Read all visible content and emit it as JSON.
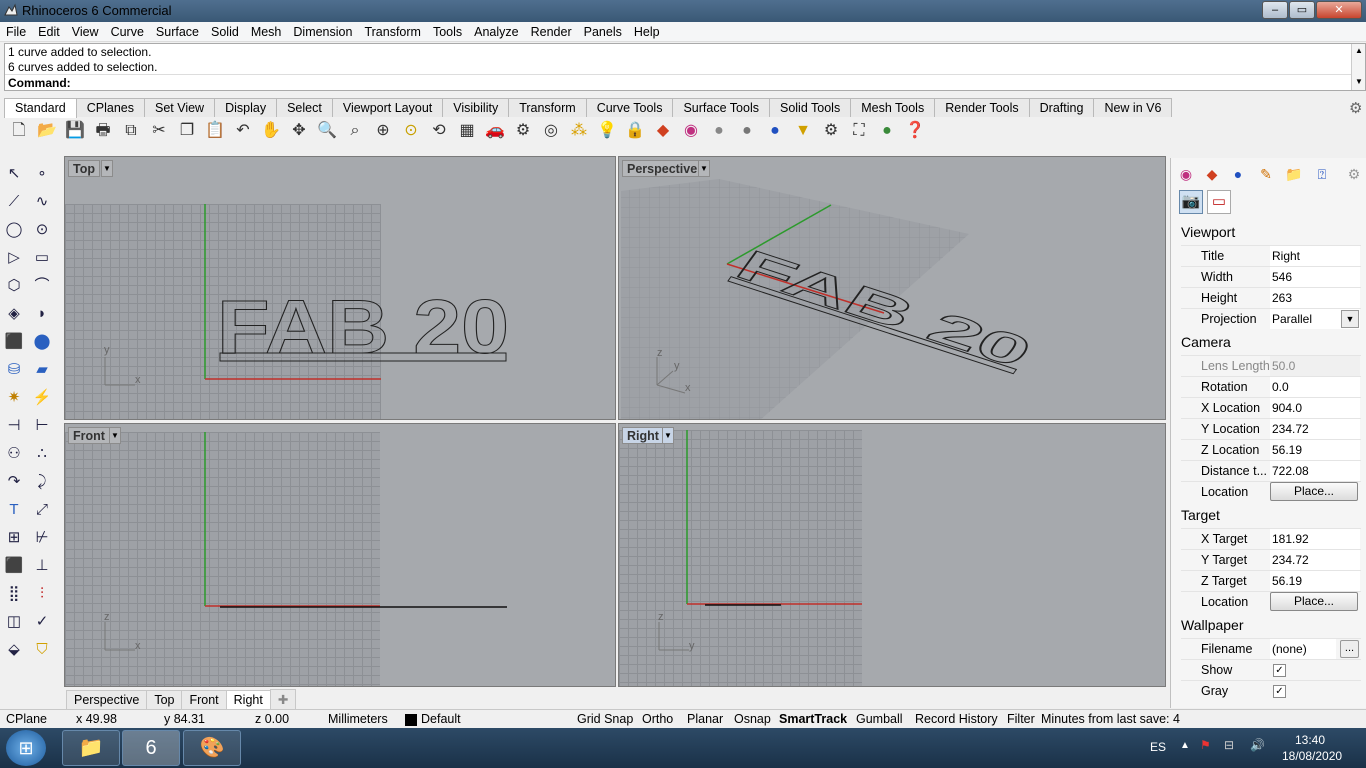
{
  "window": {
    "title": "Rhinoceros 6 Commercial",
    "minimize": "–",
    "maximize": "▭",
    "close": "✕"
  },
  "menu": [
    "File",
    "Edit",
    "View",
    "Curve",
    "Surface",
    "Solid",
    "Mesh",
    "Dimension",
    "Transform",
    "Tools",
    "Analyze",
    "Render",
    "Panels",
    "Help"
  ],
  "command": {
    "history": [
      "1 curve added to selection.",
      "6 curves added to selection."
    ],
    "prompt_label": "Command:",
    "prompt_value": ""
  },
  "toolbar_tabs": [
    "Standard",
    "CPlanes",
    "Set View",
    "Display",
    "Select",
    "Viewport Layout",
    "Visibility",
    "Transform",
    "Curve Tools",
    "Surface Tools",
    "Solid Tools",
    "Mesh Tools",
    "Render Tools",
    "Drafting",
    "New in V6"
  ],
  "toolbar_active": "Standard",
  "toolbar_icons": [
    "new-icon",
    "open-icon",
    "save-icon",
    "print-icon",
    "import-icon",
    "cut-icon",
    "copy-icon",
    "paste-icon",
    "undo-icon",
    "pan-icon",
    "rotate-view-icon",
    "zoom-icon",
    "zoom-window-icon",
    "zoom-extents-icon",
    "zoom-selected-icon",
    "undo-view-icon",
    "four-viewports-icon",
    "car-icon",
    "object-properties-icon",
    "lights-icon",
    "points-icon",
    "bulb-icon",
    "lock-icon",
    "layer-icon",
    "color-wheel-icon",
    "render-sphere-icon",
    "shaded-sphere-icon",
    "material-sphere-icon",
    "sun-icon",
    "settings-icon",
    "grid-snap-icon",
    "analyze-icon",
    "help-icon"
  ],
  "viewports": {
    "top": {
      "label": "Top",
      "axes": {
        "a": "y",
        "b": "x"
      },
      "text": "FAB 20"
    },
    "perspective": {
      "label": "Perspective",
      "axes": {
        "a": "z",
        "b": "y",
        "c": "x"
      },
      "text": "FAB 20"
    },
    "front": {
      "label": "Front",
      "axes": {
        "a": "z",
        "b": "x"
      }
    },
    "right": {
      "label": "Right",
      "axes": {
        "a": "z",
        "b": "y"
      }
    }
  },
  "viewport_tabs": [
    "Perspective",
    "Top",
    "Front",
    "Right"
  ],
  "viewport_tab_add": "✚",
  "panel": {
    "viewport_header": "Viewport",
    "viewport_rows": [
      {
        "label": "Title",
        "value": "Right"
      },
      {
        "label": "Width",
        "value": "546"
      },
      {
        "label": "Height",
        "value": "263"
      },
      {
        "label": "Projection",
        "value": "Parallel"
      }
    ],
    "camera_header": "Camera",
    "camera_rows": [
      {
        "label": "Lens Length",
        "value": "50.0"
      },
      {
        "label": "Rotation",
        "value": "0.0"
      },
      {
        "label": "X Location",
        "value": "904.0"
      },
      {
        "label": "Y Location",
        "value": "234.72"
      },
      {
        "label": "Z Location",
        "value": "56.19"
      },
      {
        "label": "Distance t...",
        "value": "722.08"
      },
      {
        "label": "Location",
        "value": "Place..."
      }
    ],
    "target_header": "Target",
    "target_rows": [
      {
        "label": "X Target",
        "value": "181.92"
      },
      {
        "label": "Y Target",
        "value": "234.72"
      },
      {
        "label": "Z Target",
        "value": "56.19"
      },
      {
        "label": "Location",
        "value": "Place..."
      }
    ],
    "wallpaper_header": "Wallpaper",
    "wallpaper_rows": [
      {
        "label": "Filename",
        "value": "(none)"
      },
      {
        "label": "Show",
        "value": "✓"
      },
      {
        "label": "Gray",
        "value": "✓"
      }
    ],
    "browse": "..."
  },
  "status": {
    "cplane": "CPlane",
    "x": "x 49.98",
    "y": "y 84.31",
    "z": "z 0.00",
    "units": "Millimeters",
    "layer": "Default",
    "toggles": [
      "Grid Snap",
      "Ortho",
      "Planar",
      "Osnap",
      "SmartTrack",
      "Gumball",
      "Record History",
      "Filter"
    ],
    "save_info": "Minutes from last save: 4"
  },
  "taskbar": {
    "lang": "ES",
    "time": "13:40",
    "date": "18/08/2020",
    "rhino_badge": "6"
  }
}
